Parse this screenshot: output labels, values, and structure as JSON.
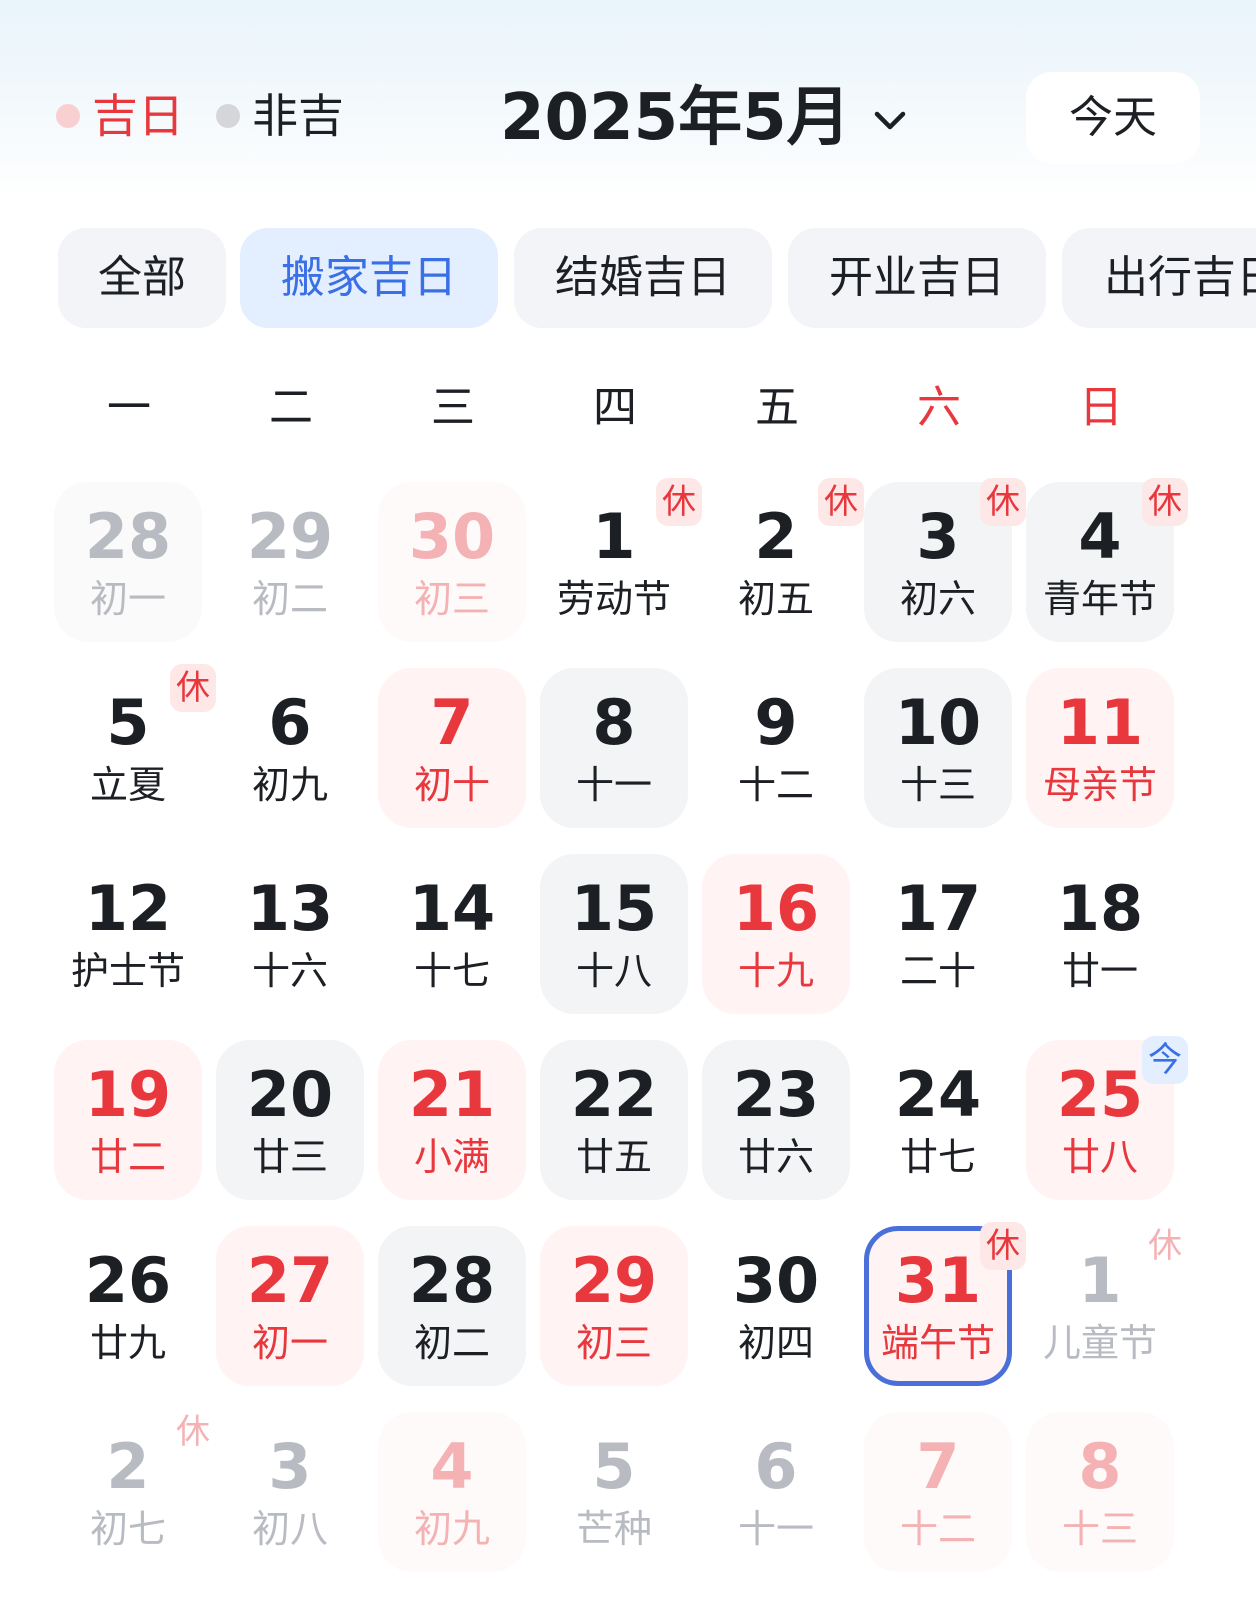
{
  "legend": {
    "good_label": "吉日",
    "good_color": "#e8383d",
    "good_dot_color": "#f9d0d2",
    "bad_label": "非吉",
    "bad_dot_color": "#d4d6da"
  },
  "header": {
    "month_title": "2025年5月",
    "month_picker_icon": "chevron-down-icon",
    "today_button": "今天"
  },
  "filters": [
    {
      "label": "全部",
      "active": false
    },
    {
      "label": "搬家吉日",
      "active": true
    },
    {
      "label": "结婚吉日",
      "active": false
    },
    {
      "label": "开业吉日",
      "active": false
    },
    {
      "label": "出行吉日",
      "active": false
    }
  ],
  "weekdays": [
    "一",
    "二",
    "三",
    "四",
    "五",
    "六",
    "日"
  ],
  "colors": {
    "accent_blue": "#3a6fe6",
    "good_red": "#e8383d",
    "selected_ring": "#4a6fd8"
  },
  "days": [
    [
      {
        "day": "28",
        "lunar": "初一",
        "other_month": true,
        "bg": "gray"
      },
      {
        "day": "29",
        "lunar": "初二",
        "other_month": true
      },
      {
        "day": "30",
        "lunar": "初三",
        "other_month": true,
        "good": true,
        "bg": "pink"
      },
      {
        "day": "1",
        "lunar": "劳动节",
        "badge": "休"
      },
      {
        "day": "2",
        "lunar": "初五",
        "badge": "休"
      },
      {
        "day": "3",
        "lunar": "初六",
        "badge": "休",
        "bg": "gray"
      },
      {
        "day": "4",
        "lunar": "青年节",
        "badge": "休",
        "bg": "gray"
      }
    ],
    [
      {
        "day": "5",
        "lunar": "立夏",
        "badge": "休"
      },
      {
        "day": "6",
        "lunar": "初九"
      },
      {
        "day": "7",
        "lunar": "初十",
        "good": true,
        "bg": "pink"
      },
      {
        "day": "8",
        "lunar": "十一",
        "bg": "gray"
      },
      {
        "day": "9",
        "lunar": "十二"
      },
      {
        "day": "10",
        "lunar": "十三",
        "bg": "gray"
      },
      {
        "day": "11",
        "lunar": "母亲节",
        "good": true,
        "bg": "pink"
      }
    ],
    [
      {
        "day": "12",
        "lunar": "护士节"
      },
      {
        "day": "13",
        "lunar": "十六"
      },
      {
        "day": "14",
        "lunar": "十七"
      },
      {
        "day": "15",
        "lunar": "十八",
        "bg": "gray"
      },
      {
        "day": "16",
        "lunar": "十九",
        "good": true,
        "bg": "pink"
      },
      {
        "day": "17",
        "lunar": "二十"
      },
      {
        "day": "18",
        "lunar": "廿一"
      }
    ],
    [
      {
        "day": "19",
        "lunar": "廿二",
        "good": true,
        "bg": "pink"
      },
      {
        "day": "20",
        "lunar": "廿三",
        "bg": "gray"
      },
      {
        "day": "21",
        "lunar": "小满",
        "good": true,
        "bg": "pink"
      },
      {
        "day": "22",
        "lunar": "廿五",
        "bg": "gray"
      },
      {
        "day": "23",
        "lunar": "廿六",
        "bg": "gray"
      },
      {
        "day": "24",
        "lunar": "廿七"
      },
      {
        "day": "25",
        "lunar": "廿八",
        "good": true,
        "bg": "pink",
        "badge": "今",
        "today": true
      }
    ],
    [
      {
        "day": "26",
        "lunar": "廿九"
      },
      {
        "day": "27",
        "lunar": "初一",
        "good": true,
        "bg": "pink"
      },
      {
        "day": "28",
        "lunar": "初二",
        "bg": "gray"
      },
      {
        "day": "29",
        "lunar": "初三",
        "good": true,
        "bg": "pink"
      },
      {
        "day": "30",
        "lunar": "初四"
      },
      {
        "day": "31",
        "lunar": "端午节",
        "good": true,
        "badge": "休",
        "selected": true
      },
      {
        "day": "1",
        "lunar": "儿童节",
        "other_month": true,
        "badge": "休"
      }
    ],
    [
      {
        "day": "2",
        "lunar": "初七",
        "other_month": true,
        "badge": "休"
      },
      {
        "day": "3",
        "lunar": "初八",
        "other_month": true
      },
      {
        "day": "4",
        "lunar": "初九",
        "other_month": true,
        "good": true,
        "bg": "pink"
      },
      {
        "day": "5",
        "lunar": "芒种",
        "other_month": true
      },
      {
        "day": "6",
        "lunar": "十一",
        "other_month": true
      },
      {
        "day": "7",
        "lunar": "十二",
        "other_month": true,
        "good": true,
        "bg": "pink"
      },
      {
        "day": "8",
        "lunar": "十三",
        "other_month": true,
        "good": true,
        "bg": "pink"
      }
    ]
  ]
}
